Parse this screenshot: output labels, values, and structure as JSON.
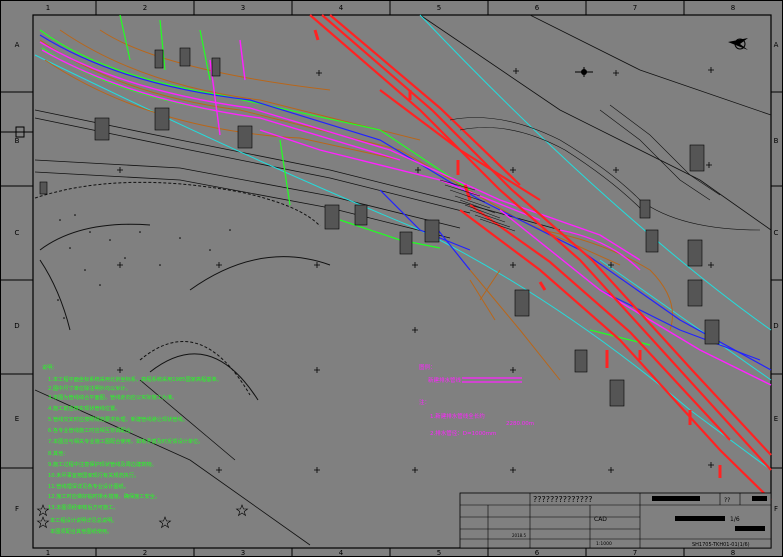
{
  "frame": {
    "col_labels": [
      "1",
      "2",
      "3",
      "4",
      "5",
      "6",
      "7",
      "8"
    ],
    "row_labels": [
      "A",
      "B",
      "C",
      "D",
      "E",
      "F"
    ]
  },
  "notes": {
    "heading": "说明：",
    "lines": [
      "1.本工程平面坐标系统采用北京坐标系，高程系统采用1985国家高程基准。",
      "2.图中尺寸单位除注明外均以米计。",
      "3.本图为管线综合平面图，管线走向应以实际施工为准。",
      "4.施工前应核实现状管线位置。",
      "5.管线交叉时应按照规范要求处理，新建管线避让现状管线。",
      "6.各专业管线施工时应相互协调配合。",
      "7.本图应与相关专业施工图配合使用，如有矛盾及时反馈设计单位。",
      "8.其他：",
      "9.施工过程中注意保护现状管线及周边建筑物。",
      "10.未尽事宜按国家现行有关规范执行。",
      "11.管线埋深详见各专业设计图纸。",
      "12.施工时应做好临时排水措施，确保施工安全。",
      "13.本图须经审核后方可施工。"
    ],
    "starred": [
      "本工程设计说明详见总说明。",
      "本图须配合其他图纸使用。"
    ]
  },
  "legend": {
    "heading": "图例：",
    "line_label": "新建排水管线",
    "notes_heading": "注：",
    "note1": "1.新建排水管线全长约",
    "note1_value": "2280.00m",
    "note2": "2.排水管径：D=1000mm"
  },
  "title_block": {
    "project": "??????????????",
    "sheet_label": "CAD",
    "date": "2018.5",
    "drawing_no": "SH1705-TKH01-01(1/6)",
    "scale": "1:1000",
    "page": "1/6"
  },
  "colors": {
    "background": "#808080",
    "green": "#22ff22",
    "magenta": "#ff22ff",
    "red": "#ff2222",
    "cyan": "#22dddd",
    "blue": "#2222ff",
    "brown": "#b8661a",
    "black": "#000000",
    "white": "#ffffff"
  }
}
